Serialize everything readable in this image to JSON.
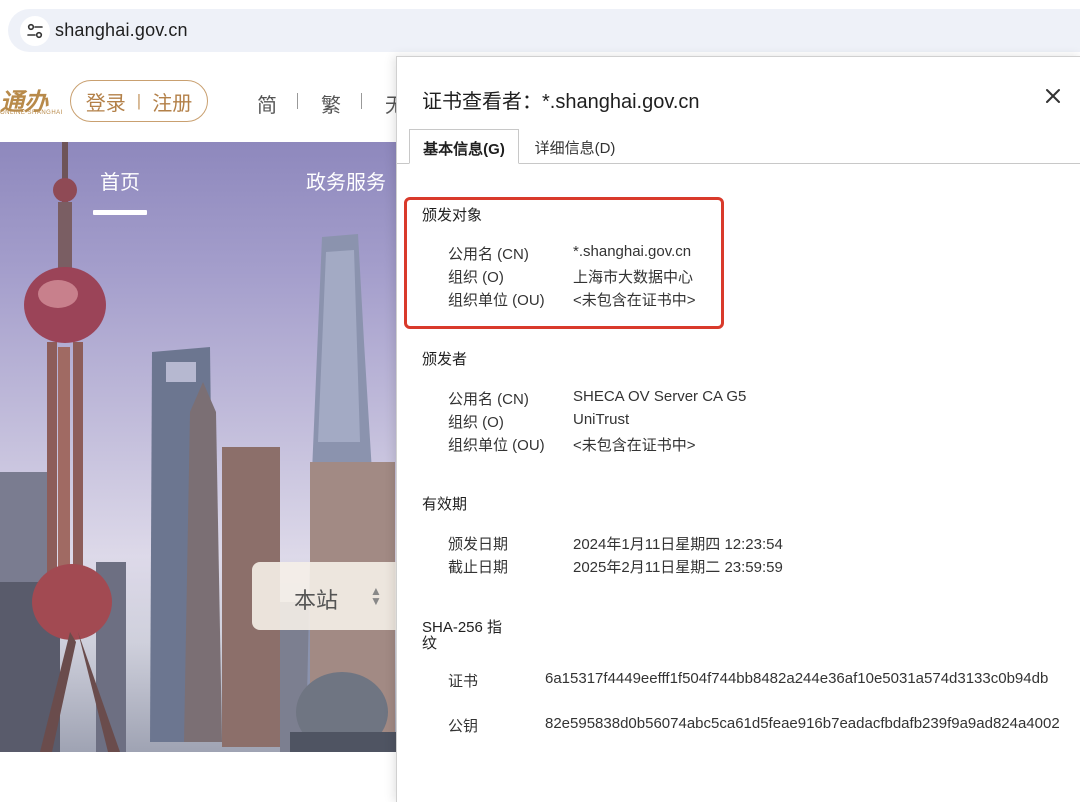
{
  "browser": {
    "url": "shanghai.gov.cn",
    "site_info_icon": "tune-icon"
  },
  "page": {
    "logo_text": "通办",
    "logo_sub": "ONLINE SHANGHAI",
    "login_label": "登录",
    "register_label": "注册",
    "lang_options": [
      "简",
      "繁",
      "无"
    ],
    "nav": [
      "首页",
      "政务服务"
    ],
    "search_scope": "本站"
  },
  "dialog": {
    "title": "证书查看者：*.shanghai.gov.cn",
    "tabs": [
      {
        "label": "基本信息(G)",
        "active": true
      },
      {
        "label": "详细信息(D)",
        "active": false
      }
    ],
    "highlight_color": "#d93a2b",
    "sections": {
      "subject": {
        "title": "颁发对象",
        "rows": [
          {
            "label": "公用名 (CN)",
            "value": "*.shanghai.gov.cn"
          },
          {
            "label": "组织 (O)",
            "value": "上海市大数据中心"
          },
          {
            "label": "组织单位 (OU)",
            "value": "<未包含在证书中>"
          }
        ]
      },
      "issuer": {
        "title": "颁发者",
        "rows": [
          {
            "label": "公用名 (CN)",
            "value": "SHECA OV Server CA G5"
          },
          {
            "label": "组织 (O)",
            "value": "UniTrust"
          },
          {
            "label": "组织单位 (OU)",
            "value": "<未包含在证书中>"
          }
        ]
      },
      "validity": {
        "title": "有效期",
        "rows": [
          {
            "label": "颁发日期",
            "value": "2024年1月11日星期四 12:23:54"
          },
          {
            "label": "截止日期",
            "value": "2025年2月11日星期二 23:59:59"
          }
        ]
      },
      "fingerprints": {
        "title_line1": "SHA-256 指",
        "title_line2": "纹",
        "rows": [
          {
            "label": "证书",
            "value": "6a15317f4449eefff1f504f744bb8482a244e36af10e5031a574d3133c0b94db"
          },
          {
            "label": "公钥",
            "value": "82e595838d0b56074abc5ca61d5feae916b7eadacfbdafb239f9a9ad824a4002"
          }
        ]
      }
    }
  }
}
